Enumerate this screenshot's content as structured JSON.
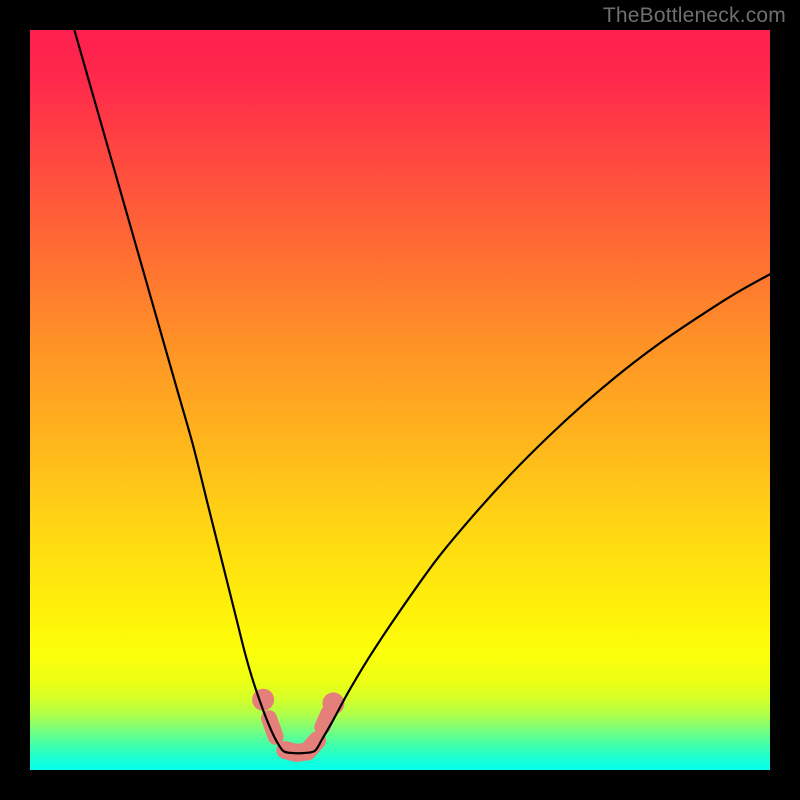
{
  "watermark": "TheBottleneck.com",
  "chart_data": {
    "type": "line",
    "title": "",
    "xlabel": "",
    "ylabel": "",
    "xlim": [
      0,
      100
    ],
    "ylim": [
      0,
      100
    ],
    "grid": false,
    "legend": false,
    "series": [
      {
        "name": "curve-left",
        "x": [
          6,
          8,
          10,
          12,
          14,
          16,
          18,
          20,
          22,
          24,
          25,
          26,
          27,
          28,
          29,
          30,
          31,
          32,
          33,
          34.2
        ],
        "y": [
          100,
          93,
          86,
          79,
          72,
          65,
          58,
          51,
          44,
          36,
          32,
          28,
          24,
          20,
          16,
          12.5,
          9.5,
          6.8,
          4.5,
          2.6
        ]
      },
      {
        "name": "curve-right",
        "x": [
          38.5,
          39.5,
          41,
          43,
          46,
          50,
          55,
          60,
          65,
          70,
          75,
          80,
          85,
          90,
          95,
          100
        ],
        "y": [
          2.6,
          4.2,
          6.8,
          10.5,
          15.5,
          21.5,
          28.5,
          34.5,
          40,
          45,
          49.6,
          53.8,
          57.6,
          61,
          64.2,
          67
        ]
      },
      {
        "name": "curve-bottom",
        "x": [
          34.2,
          35.5,
          37,
          38.5
        ],
        "y": [
          2.6,
          2.3,
          2.3,
          2.6
        ]
      }
    ],
    "markers": {
      "name": "salmon-dots",
      "color": "#e48079",
      "points": [
        {
          "x": 31.5,
          "y": 9.5,
          "r": 0.9
        },
        {
          "x": 32.3,
          "y": 7.0,
          "r": 1.3
        },
        {
          "x": 33.2,
          "y": 4.5,
          "r": 1.3
        },
        {
          "x": 34.5,
          "y": 2.7,
          "r": 1.3
        },
        {
          "x": 36.0,
          "y": 2.3,
          "r": 1.4
        },
        {
          "x": 37.5,
          "y": 2.5,
          "r": 1.4
        },
        {
          "x": 38.8,
          "y": 4.0,
          "r": 1.3
        },
        {
          "x": 39.5,
          "y": 5.8,
          "r": 1.3
        },
        {
          "x": 40.3,
          "y": 7.6,
          "r": 1.0
        },
        {
          "x": 41.0,
          "y": 9.0,
          "r": 0.9
        }
      ]
    },
    "background_gradient": {
      "stops": [
        {
          "offset": 0.0,
          "color": "#ff1f4f"
        },
        {
          "offset": 0.07,
          "color": "#ff2a4b"
        },
        {
          "offset": 0.18,
          "color": "#ff4a3f"
        },
        {
          "offset": 0.3,
          "color": "#ff6d33"
        },
        {
          "offset": 0.42,
          "color": "#ff9127"
        },
        {
          "offset": 0.55,
          "color": "#ffb41d"
        },
        {
          "offset": 0.68,
          "color": "#ffd813"
        },
        {
          "offset": 0.78,
          "color": "#fff00a"
        },
        {
          "offset": 0.84,
          "color": "#fdff0a"
        },
        {
          "offset": 0.88,
          "color": "#edff14"
        },
        {
          "offset": 0.905,
          "color": "#d3ff2a"
        },
        {
          "offset": 0.925,
          "color": "#b0ff4a"
        },
        {
          "offset": 0.94,
          "color": "#88ff6e"
        },
        {
          "offset": 0.955,
          "color": "#5eff92"
        },
        {
          "offset": 0.97,
          "color": "#38ffb4"
        },
        {
          "offset": 0.985,
          "color": "#1affd4"
        },
        {
          "offset": 1.0,
          "color": "#05ffee"
        }
      ]
    }
  }
}
